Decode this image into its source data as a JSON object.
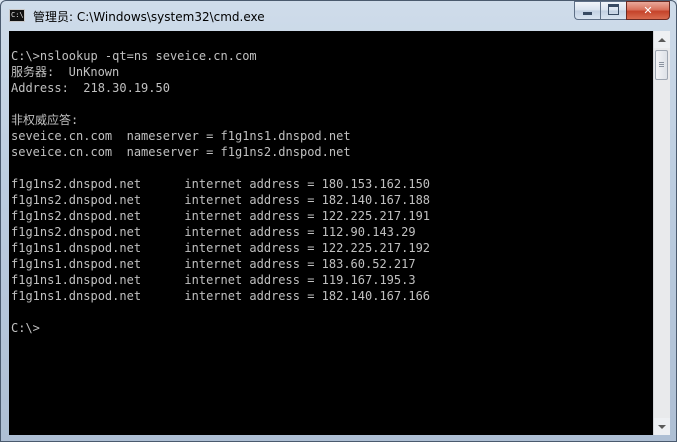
{
  "window": {
    "icon_text": "C:\\",
    "title": "管理员: C:\\Windows\\system32\\cmd.exe",
    "minimize_icon": "minimize-icon",
    "maximize_icon": "maximize-icon",
    "close_icon": "close-icon",
    "close_glyph": "✕"
  },
  "console": {
    "lines": [
      "C:\\>nslookup -qt=ns seveice.cn.com",
      "服务器:  UnKnown",
      "Address:  218.30.19.50",
      "",
      "非权威应答:",
      "seveice.cn.com  nameserver = f1g1ns1.dnspod.net",
      "seveice.cn.com  nameserver = f1g1ns2.dnspod.net",
      "",
      "f1g1ns2.dnspod.net      internet address = 180.153.162.150",
      "f1g1ns2.dnspod.net      internet address = 182.140.167.188",
      "f1g1ns2.dnspod.net      internet address = 122.225.217.191",
      "f1g1ns2.dnspod.net      internet address = 112.90.143.29",
      "f1g1ns1.dnspod.net      internet address = 122.225.217.192",
      "f1g1ns1.dnspod.net      internet address = 183.60.52.217",
      "f1g1ns1.dnspod.net      internet address = 119.167.195.3",
      "f1g1ns1.dnspod.net      internet address = 182.140.167.166",
      "",
      "C:\\>"
    ]
  },
  "colors": {
    "console_bg": "#000000",
    "console_fg": "#c0c0c0",
    "close_button": "#c5432a"
  }
}
